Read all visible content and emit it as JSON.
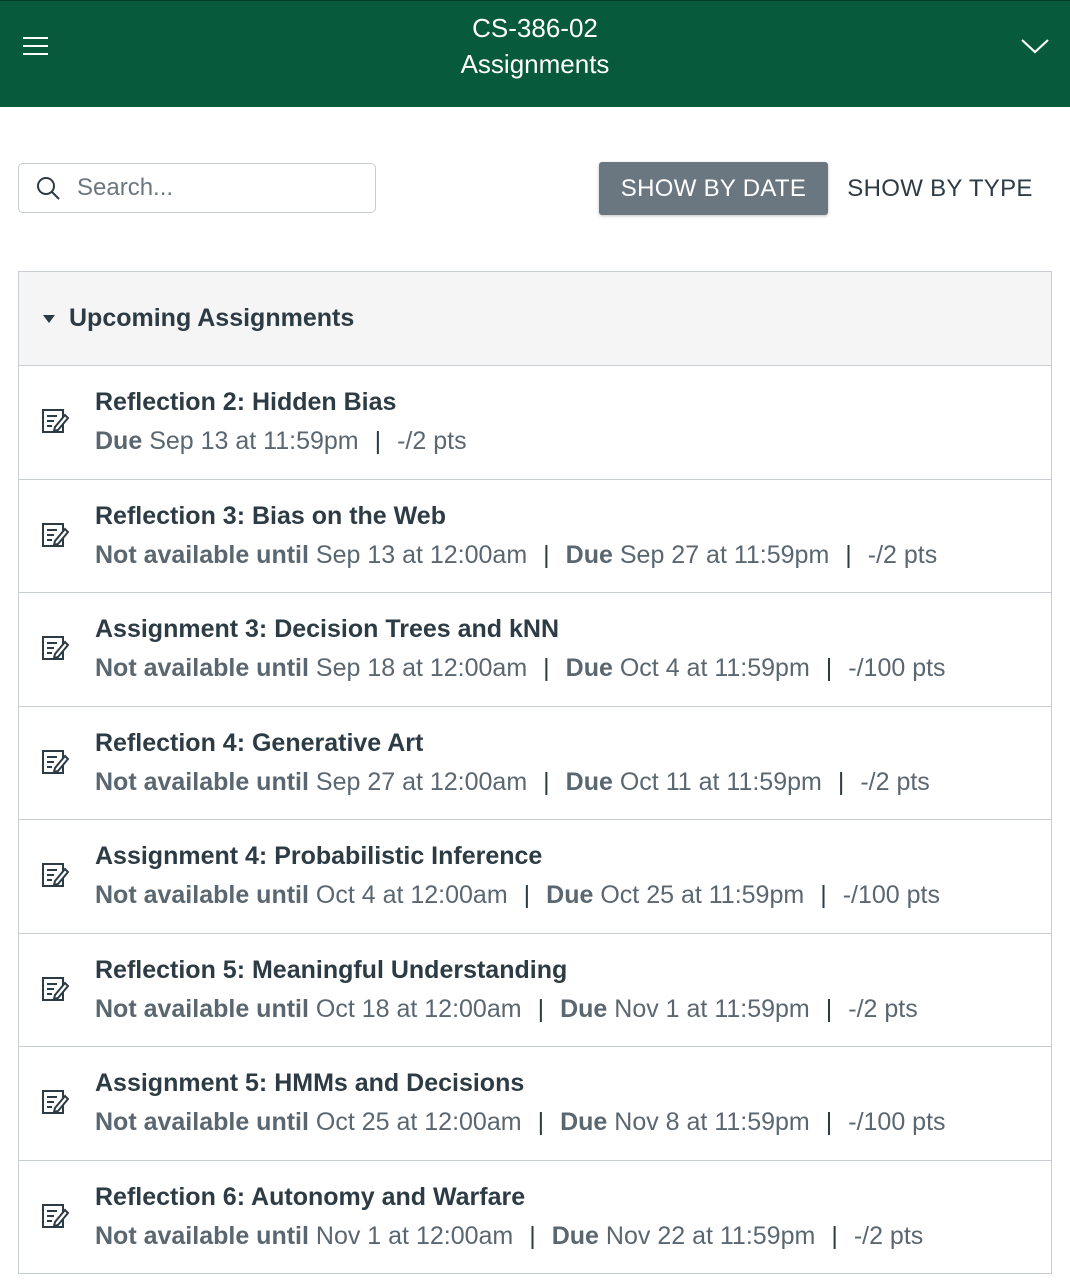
{
  "header": {
    "course": "CS-386-02",
    "page": "Assignments"
  },
  "search": {
    "placeholder": "Search..."
  },
  "toggles": {
    "by_date": "SHOW BY DATE",
    "by_type": "SHOW BY TYPE"
  },
  "group": {
    "title": "Upcoming Assignments"
  },
  "labels": {
    "not_available": "Not available until",
    "due": "Due"
  },
  "assignments": [
    {
      "name": "Reflection 2: Hidden Bias",
      "available": "",
      "due": "Sep 13 at 11:59pm",
      "points": "-/2 pts"
    },
    {
      "name": "Reflection 3: Bias on the Web",
      "available": "Sep 13 at 12:00am",
      "due": "Sep 27 at 11:59pm",
      "points": "-/2 pts"
    },
    {
      "name": "Assignment 3: Decision Trees and kNN",
      "available": "Sep 18 at 12:00am",
      "due": "Oct 4 at 11:59pm",
      "points": "-/100 pts"
    },
    {
      "name": "Reflection 4: Generative Art",
      "available": "Sep 27 at 12:00am",
      "due": "Oct 11 at 11:59pm",
      "points": "-/2 pts"
    },
    {
      "name": "Assignment 4: Probabilistic Inference",
      "available": "Oct 4 at 12:00am",
      "due": "Oct 25 at 11:59pm",
      "points": "-/100 pts"
    },
    {
      "name": "Reflection 5: Meaningful Understanding",
      "available": "Oct 18 at 12:00am",
      "due": "Nov 1 at 11:59pm",
      "points": "-/2 pts"
    },
    {
      "name": "Assignment 5: HMMs and Decisions",
      "available": "Oct 25 at 12:00am",
      "due": "Nov 8 at 11:59pm",
      "points": "-/100 pts"
    },
    {
      "name": "Reflection 6: Autonomy and Warfare",
      "available": "Nov 1 at 12:00am",
      "due": "Nov 22 at 11:59pm",
      "points": "-/2 pts"
    }
  ],
  "colors": {
    "header_bg": "#075a3c",
    "active_toggle": "#6b7780"
  },
  "icons": {
    "menu": "hamburger-icon",
    "expand": "chevron-down-icon",
    "search": "search-icon",
    "group": "caret-down-icon",
    "assignment": "assignment-icon"
  }
}
